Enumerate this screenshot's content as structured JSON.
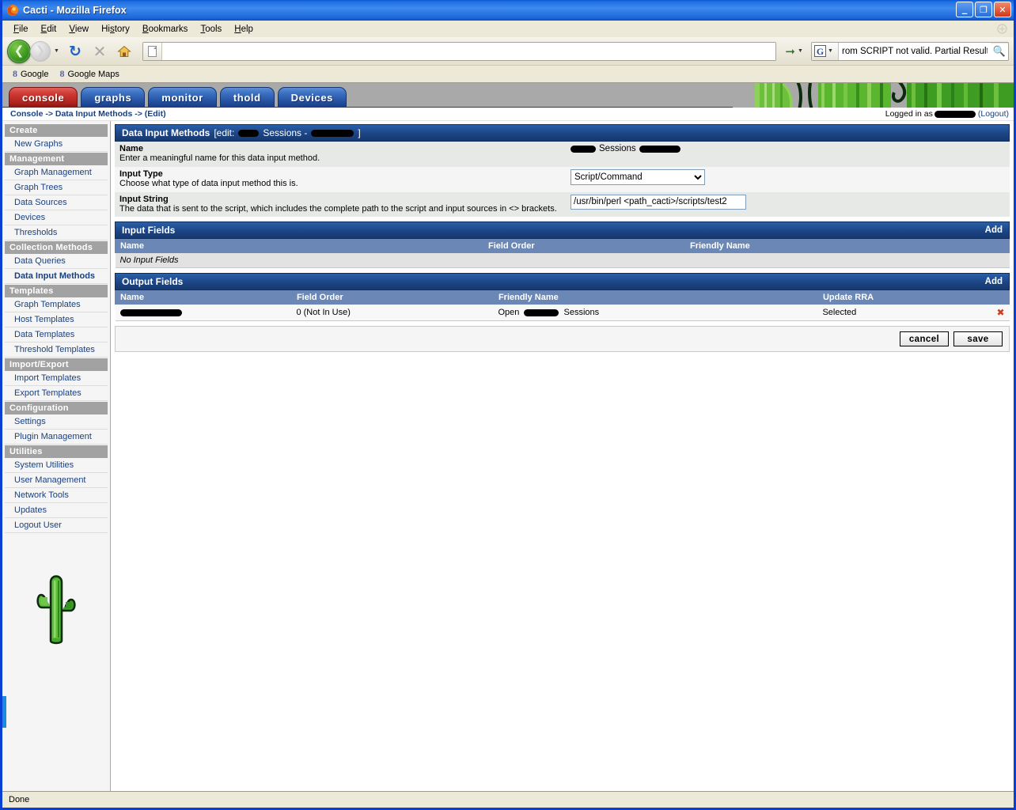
{
  "window": {
    "title": "Cacti - Mozilla Firefox",
    "icon": "firefox-icon",
    "minimize_label": "_",
    "restore_label": "❐",
    "close_label": "✕"
  },
  "menubar": {
    "items": [
      {
        "label": "File",
        "accel": "F"
      },
      {
        "label": "Edit",
        "accel": "E"
      },
      {
        "label": "View",
        "accel": "V"
      },
      {
        "label": "History",
        "accel": "s"
      },
      {
        "label": "Bookmarks",
        "accel": "B"
      },
      {
        "label": "Tools",
        "accel": "T"
      },
      {
        "label": "Help",
        "accel": "H"
      }
    ]
  },
  "toolbar": {
    "back_icon": "back-arrow-icon",
    "forward_icon": "forward-arrow-icon",
    "history_dropdown_icon": "chevron-down-icon",
    "reload_icon": "reload-icon",
    "stop_icon": "stop-icon",
    "home_icon": "home-icon",
    "url_value": "",
    "url_placeholder": "",
    "go_icon": "go-arrow-icon",
    "go_dropdown_icon": "chevron-down-icon",
    "search_engine": "G",
    "search_value": "rom SCRIPT not valid. Partial Result: ...",
    "search_placeholder": "Search",
    "search_icon": "magnifier-icon"
  },
  "bookmarks": {
    "items": [
      {
        "label": "Google",
        "icon": "google-bookmark-icon"
      },
      {
        "label": "Google Maps",
        "icon": "google-maps-bookmark-icon"
      }
    ]
  },
  "cacti": {
    "tabs": [
      {
        "label": "console",
        "active": true
      },
      {
        "label": "graphs",
        "active": false
      },
      {
        "label": "monitor",
        "active": false
      },
      {
        "label": "thold",
        "active": false
      },
      {
        "label": "Devices",
        "active": false
      }
    ],
    "breadcrumb": "Console -> Data Input Methods -> (Edit)",
    "logged_in_prefix": "Logged in as",
    "logged_in_user": "",
    "logout_label": "(Logout)",
    "sidebar": [
      {
        "type": "header",
        "label": "Create"
      },
      {
        "type": "item",
        "label": "New Graphs",
        "current": false
      },
      {
        "type": "header",
        "label": "Management"
      },
      {
        "type": "item",
        "label": "Graph Management",
        "current": false
      },
      {
        "type": "item",
        "label": "Graph Trees",
        "current": false
      },
      {
        "type": "item",
        "label": "Data Sources",
        "current": false
      },
      {
        "type": "item",
        "label": "Devices",
        "current": false
      },
      {
        "type": "item",
        "label": "Thresholds",
        "current": false
      },
      {
        "type": "header",
        "label": "Collection Methods"
      },
      {
        "type": "item",
        "label": "Data Queries",
        "current": false
      },
      {
        "type": "item",
        "label": "Data Input Methods",
        "current": true
      },
      {
        "type": "header",
        "label": "Templates"
      },
      {
        "type": "item",
        "label": "Graph Templates",
        "current": false
      },
      {
        "type": "item",
        "label": "Host Templates",
        "current": false
      },
      {
        "type": "item",
        "label": "Data Templates",
        "current": false
      },
      {
        "type": "item",
        "label": "Threshold Templates",
        "current": false
      },
      {
        "type": "header",
        "label": "Import/Export"
      },
      {
        "type": "item",
        "label": "Import Templates",
        "current": false
      },
      {
        "type": "item",
        "label": "Export Templates",
        "current": false
      },
      {
        "type": "header",
        "label": "Configuration"
      },
      {
        "type": "item",
        "label": "Settings",
        "current": false
      },
      {
        "type": "item",
        "label": "Plugin Management",
        "current": false
      },
      {
        "type": "header",
        "label": "Utilities"
      },
      {
        "type": "item",
        "label": "System Utilities",
        "current": false
      },
      {
        "type": "item",
        "label": "User Management",
        "current": false
      },
      {
        "type": "item",
        "label": "Network Tools",
        "current": false
      },
      {
        "type": "item",
        "label": "Updates",
        "current": false
      },
      {
        "type": "item",
        "label": "Logout User",
        "current": false
      }
    ],
    "logo_icon": "cactus-logo-icon"
  },
  "form_panel": {
    "title_main": "Data Input Methods",
    "title_edit_prefix": "[edit:",
    "title_edit_middle": "Sessions -",
    "title_edit_suffix": "]",
    "fields": {
      "name": {
        "label": "Name",
        "description": "Enter a meaningful name for this data input method.",
        "value_suffix_text": "Sessions",
        "value": ""
      },
      "input_type": {
        "label": "Input Type",
        "description": "Choose what type of data input method this is.",
        "value": "Script/Command",
        "options": [
          "Script/Command"
        ]
      },
      "input_string": {
        "label": "Input String",
        "description": "The data that is sent to the script, which includes the complete path to the script and input sources in <> brackets.",
        "value": "/usr/bin/perl <path_cacti>/scripts/test2"
      }
    }
  },
  "input_fields_panel": {
    "title": "Input Fields",
    "add_label": "Add",
    "columns": [
      "Name",
      "Field Order",
      "Friendly Name"
    ],
    "empty_message": "No Input Fields",
    "rows": []
  },
  "output_fields_panel": {
    "title": "Output Fields",
    "add_label": "Add",
    "columns": [
      "Name",
      "Field Order",
      "Friendly Name",
      "Update RRA"
    ],
    "rows": [
      {
        "name": "",
        "field_order": "0 (Not In Use)",
        "friendly_name_prefix": "Open",
        "friendly_name_suffix": "Sessions",
        "update_rra": "Selected",
        "delete_icon": "delete-x-icon"
      }
    ]
  },
  "actions": {
    "cancel_label": "cancel",
    "save_label": "save"
  },
  "statusbar": {
    "text": "Done"
  },
  "colors": {
    "titlebar_blue": "#1f6fe0",
    "panel_header_blue": "#1c4585",
    "grid_header_blue": "#6a87b5",
    "active_tab_red": "#cf3b35",
    "tab_blue": "#3b6fc0",
    "link_navy": "#19407f",
    "delete_red": "#d23b1e",
    "cactus_green": "#3aa32a"
  }
}
